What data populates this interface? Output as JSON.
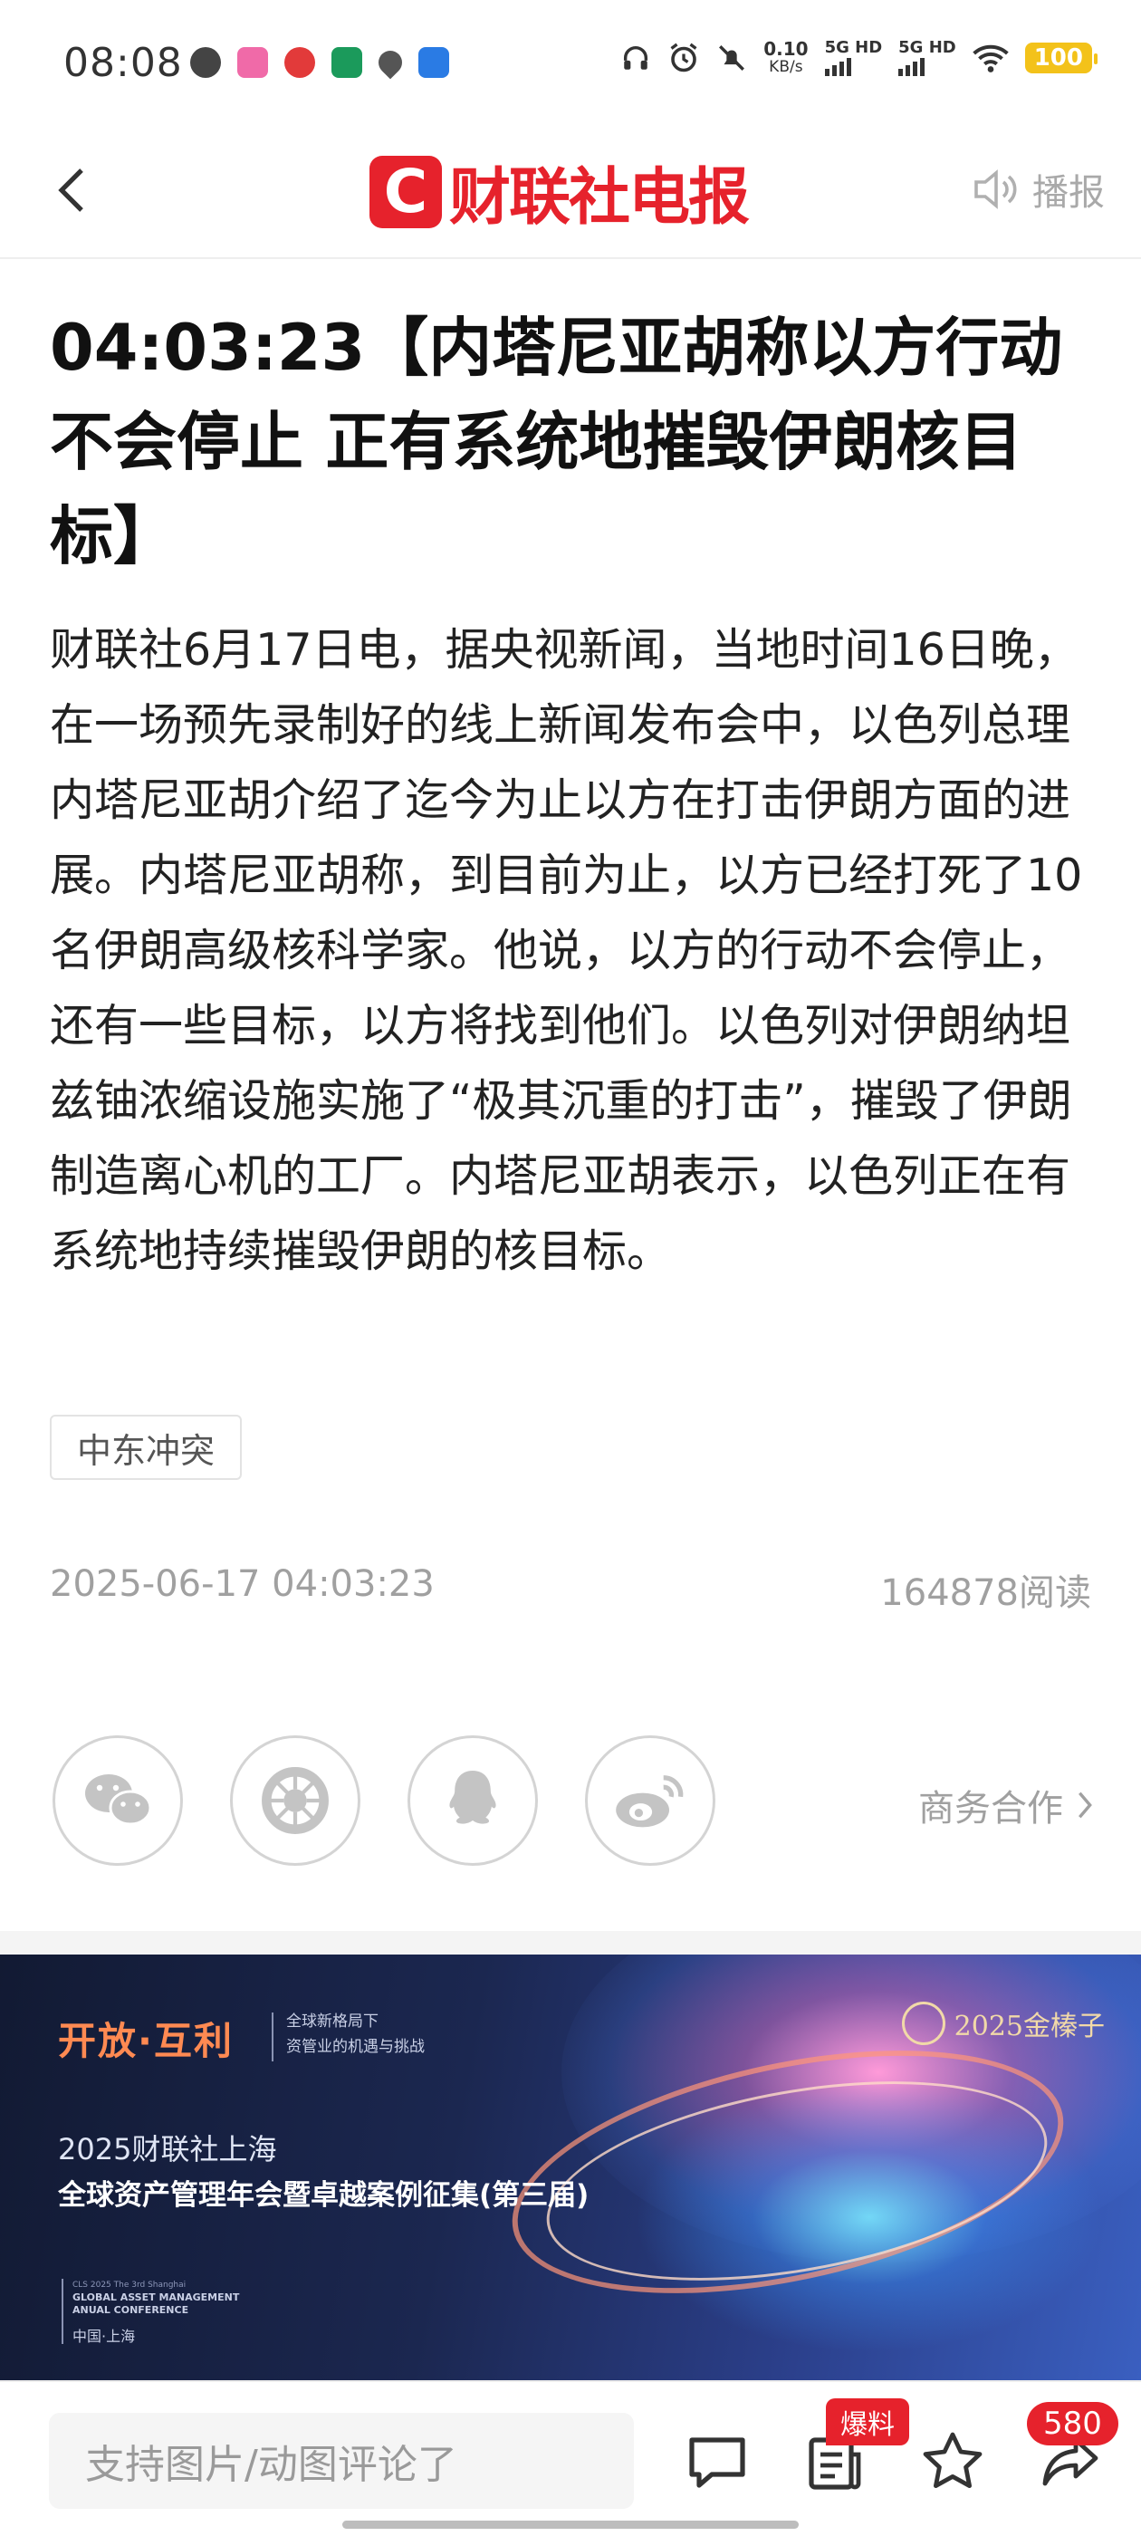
{
  "status_bar": {
    "time": "08:08",
    "net_speed": "0.10",
    "net_unit": "KB/s",
    "sim1": "5G HD",
    "sim2": "5G HD",
    "battery": "100"
  },
  "nav": {
    "logo_text": "财联社电报",
    "logo_mark": "C",
    "broadcast_label": "播报"
  },
  "article": {
    "title": "04:03:23【内塔尼亚胡称以方行动不会停止 正有系统地摧毁伊朗核目标】",
    "body": "财联社6月17日电，据央视新闻，当地时间16日晚，在一场预先录制好的线上新闻发布会中，以色列总理内塔尼亚胡介绍了迄今为止以方在打击伊朗方面的进展。内塔尼亚胡称，到目前为止，以方已经打死了10名伊朗高级核科学家。他说，以方的行动不会停止，还有一些目标，以方将找到他们。以色列对伊朗纳坦兹铀浓缩设施实施了“极其沉重的打击”，摧毁了伊朗制造离心机的工厂。内塔尼亚胡表示，以色列正在有系统地持续摧毁伊朗的核目标。",
    "tag": "中东冲突",
    "datetime": "2025-06-17 04:03:23",
    "reads": "164878阅读"
  },
  "share": {
    "business_label": "商务合作"
  },
  "banner": {
    "slogan": "开放·互利",
    "sub_line1": "全球新格局下",
    "sub_line2": "资管业的机遇与挑战",
    "brand_name": "2025金榛子",
    "year_line": "2025财联社上海",
    "headline": "全球资产管理年会暨卓越案例征集(第三届)",
    "en_small": "CLS 2025 The 3rd Shanghai",
    "en_line1": "GLOBAL ASSET MANAGEMENT",
    "en_line2": "ANUAL CONFERENCE",
    "location": "中国·上海"
  },
  "bottom_bar": {
    "comment_placeholder": "支持图片/动图评论了",
    "tip_badge": "爆料",
    "share_count": "580"
  },
  "colors": {
    "brand_red": "#e6222c",
    "battery_yellow": "#f3c21a",
    "muted_gray": "#a0a0a0"
  }
}
